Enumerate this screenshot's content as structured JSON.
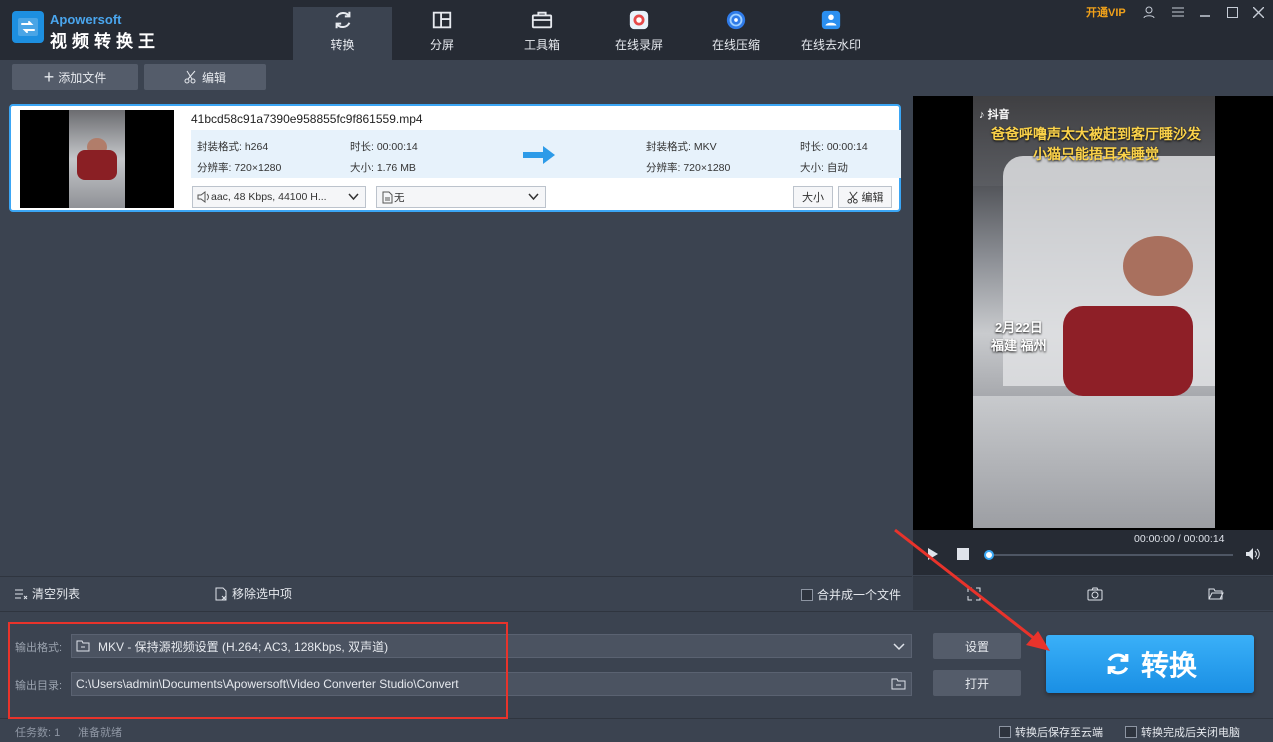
{
  "app": {
    "brand_en": "Apowersoft",
    "brand_cn": "视频转换王",
    "vip": "开通VIP"
  },
  "tabs": [
    {
      "label": "转换",
      "icon": "refresh-icon",
      "active": true
    },
    {
      "label": "分屏",
      "icon": "split-screen-icon"
    },
    {
      "label": "工具箱",
      "icon": "toolbox-icon"
    },
    {
      "label": "在线录屏",
      "icon": "screen-record-icon"
    },
    {
      "label": "在线压缩",
      "icon": "compress-icon"
    },
    {
      "label": "在线去水印",
      "icon": "watermark-remove-icon"
    }
  ],
  "toolbar": {
    "add_file": "添加文件",
    "edit": "编辑"
  },
  "file": {
    "name": "41bcd58c91a7390e958855fc9f861559.mp4",
    "src_format_label": "封装格式: h264",
    "src_duration_label": "时长: 00:00:14",
    "src_resolution_label": "分辨率: 720×1280",
    "src_size_label": "大小: 1.76 MB",
    "dst_format_label": "封装格式: MKV",
    "dst_duration_label": "时长: 00:00:14",
    "dst_resolution_label": "分辨率: 720×1280",
    "dst_size_label": "大小: 自动",
    "audio_track": "aac, 48 Kbps, 44100 H...",
    "subtitle": "无",
    "size_button": "大小",
    "edit_button": "编辑"
  },
  "preview": {
    "overlay_app": "抖音",
    "caption_line1": "爸爸呼噜声太大被赶到客厅睡沙发",
    "caption_line2": "小猫只能捂耳朵睡觉",
    "date_text": "2月22日",
    "place_text": "福建 福州",
    "time_display": "00:00:00 / 00:00:14",
    "progress": 0.0
  },
  "list_actions": {
    "clear": "清空列表",
    "remove_selected": "移除选中项",
    "merge": "合并成一个文件"
  },
  "output": {
    "format_label": "输出格式:",
    "format_value": "MKV - 保持源视频设置 (H.264; AC3, 128Kbps, 双声道)",
    "dir_label": "输出目录:",
    "dir_value": "C:\\Users\\admin\\Documents\\Apowersoft\\Video Converter Studio\\Convert",
    "settings_button": "设置",
    "open_button": "打开",
    "convert_button": "转换"
  },
  "status": {
    "task_count": "任务数: 1",
    "state": "准备就绪",
    "save_cloud": "转换后保存至云端",
    "shutdown": "转换完成后关闭电脑"
  },
  "colors": {
    "accent": "#1d8fe0",
    "annotation": "#e8332b",
    "vip": "#f0a11a"
  }
}
